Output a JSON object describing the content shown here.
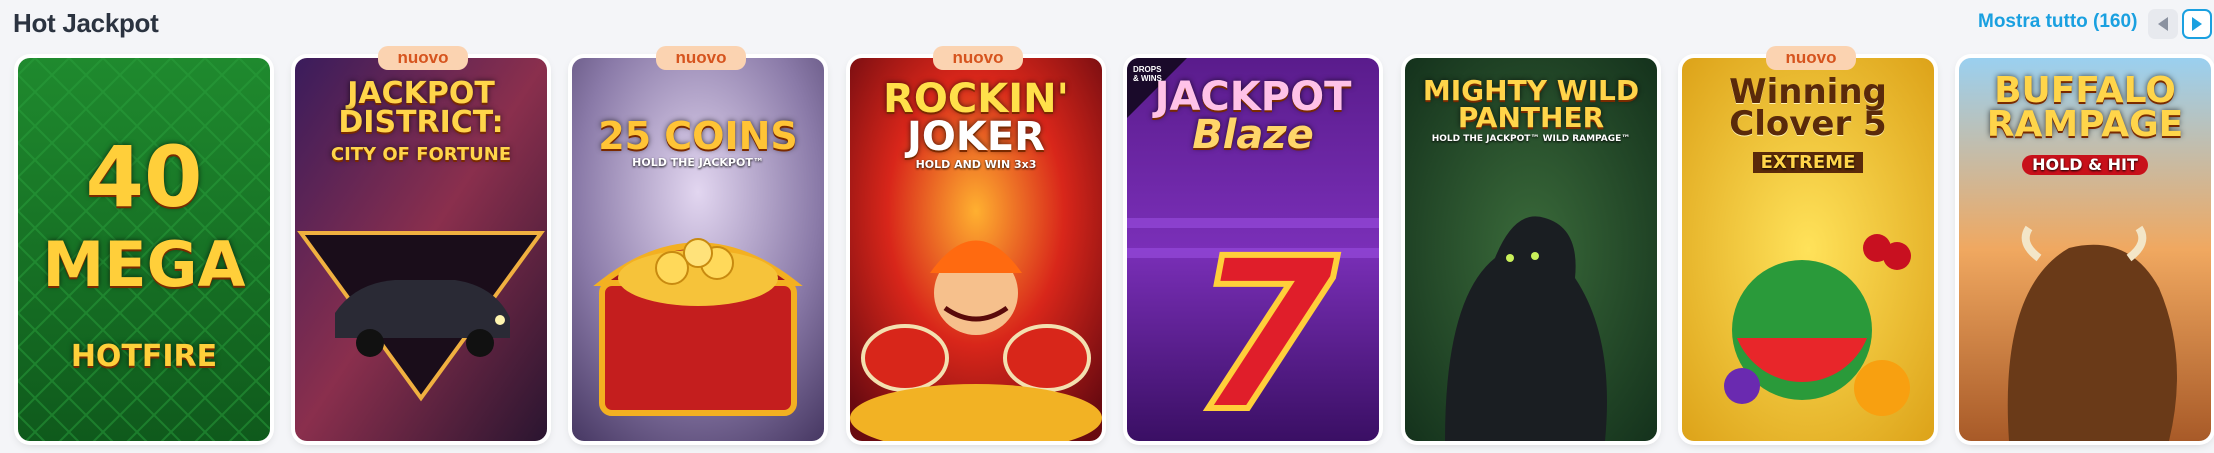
{
  "section": {
    "title": "Hot Jackpot",
    "show_all": "Mostra tutto (160)"
  },
  "badge_label": "nuovo",
  "games": [
    {
      "title_lines": [
        "40",
        "MEGA",
        "HOTFIRE"
      ],
      "badge": false
    },
    {
      "title_lines": [
        "JACKPOT",
        "DISTRICT:",
        "CITY OF FORTUNE"
      ],
      "badge": true
    },
    {
      "title_lines": [
        "25 COINS"
      ],
      "subtitle": "HOLD THE JACKPOT™",
      "badge": true
    },
    {
      "title_lines": [
        "ROCKIN'",
        "JOKER"
      ],
      "subtitle": "HOLD AND WIN 3x3",
      "badge": true
    },
    {
      "title_lines": [
        "JACKPOT",
        "Blaze"
      ],
      "tag": "DROPS & WINS",
      "badge": false
    },
    {
      "title_lines": [
        "MIGHTY WILD",
        "PANTHER"
      ],
      "subtitle": "HOLD THE JACKPOT™ WILD RAMPAGE™",
      "badge": false
    },
    {
      "title_lines": [
        "Winning",
        "Clover 5"
      ],
      "subtitle": "EXTREME",
      "badge": true
    },
    {
      "title_lines": [
        "BUFFALO",
        "RAMPAGE"
      ],
      "subtitle": "HOLD & HIT",
      "badge": false
    }
  ],
  "g": {
    "t0": "40",
    "t0b": "MEGA",
    "t0c": "HOTFIRE",
    "t1": "JACKPOT",
    "t1b": "DISTRICT:",
    "t1c": "CITY OF FORTUNE",
    "t2": "25 COINS",
    "t2s": "HOLD THE JACKPOT™",
    "t3": "ROCKIN'",
    "t3b": "JOKER",
    "t3s": "HOLD AND WIN 3x3",
    "t4": "JACKPOT",
    "t4b": "Blaze",
    "t4tag": "DROPS & WINS",
    "t5": "MIGHTY WILD",
    "t5b": "PANTHER",
    "t5s": "HOLD THE JACKPOT™ WILD RAMPAGE™",
    "t6": "Winning",
    "t6b": "Clover 5",
    "t6s": "EXTREME",
    "t7": "BUFFALO",
    "t7b": "RAMPAGE",
    "t7s": "HOLD & HIT"
  }
}
